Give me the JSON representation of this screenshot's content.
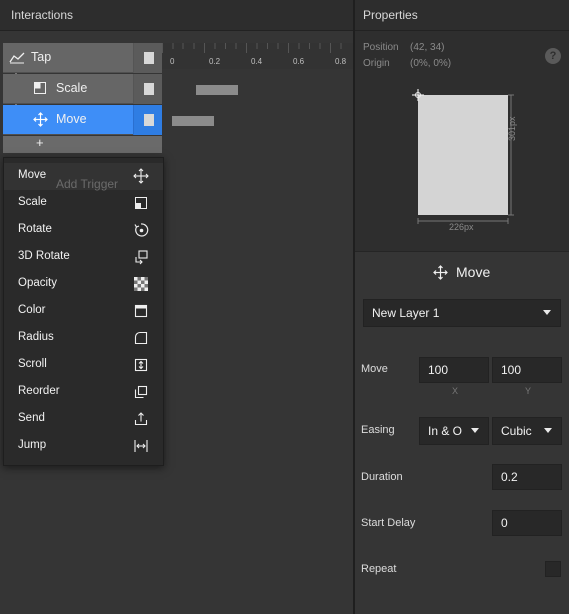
{
  "left_panel": {
    "title": "Interactions",
    "tree": {
      "trigger": "Tap",
      "animations": [
        {
          "label": "Scale",
          "icon": "scale-icon"
        },
        {
          "label": "Move",
          "icon": "move-icon"
        }
      ],
      "add_label": "+"
    },
    "timeline_ticks": [
      "0",
      "0.2",
      "0.4",
      "0.6",
      "0.8"
    ],
    "add_trigger_placeholder": "Add Trigger",
    "menu_items": [
      {
        "label": "Move",
        "icon": "move-icon"
      },
      {
        "label": "Scale",
        "icon": "scale-icon"
      },
      {
        "label": "Rotate",
        "icon": "rotate-icon"
      },
      {
        "label": "3D Rotate",
        "icon": "3d-rotate-icon"
      },
      {
        "label": "Opacity",
        "icon": "opacity-icon"
      },
      {
        "label": "Color",
        "icon": "color-icon"
      },
      {
        "label": "Radius",
        "icon": "radius-icon"
      },
      {
        "label": "Scroll",
        "icon": "scroll-icon"
      },
      {
        "label": "Reorder",
        "icon": "reorder-icon"
      },
      {
        "label": "Send",
        "icon": "send-icon"
      },
      {
        "label": "Jump",
        "icon": "jump-icon"
      }
    ]
  },
  "right_panel": {
    "title": "Properties",
    "position_label": "Position",
    "position_value": "(42, 34)",
    "origin_label": "Origin",
    "origin_value": "(0%, 0%)",
    "help": "?",
    "width_dim": "226px",
    "height_dim": "301px",
    "inspector": {
      "title": "Move",
      "layer_select": "New Layer 1",
      "move_label": "Move",
      "move_x": "100",
      "move_y": "100",
      "x_label": "X",
      "y_label": "Y",
      "easing_label": "Easing",
      "easing_in_out": "In & O",
      "easing_curve": "Cubic",
      "duration_label": "Duration",
      "duration_value": "0.2",
      "start_delay_label": "Start Delay",
      "start_delay_value": "0",
      "repeat_label": "Repeat"
    }
  },
  "colors": {
    "accent": "#3e8ef7",
    "panel": "#353535",
    "header": "#2d2d2d"
  }
}
